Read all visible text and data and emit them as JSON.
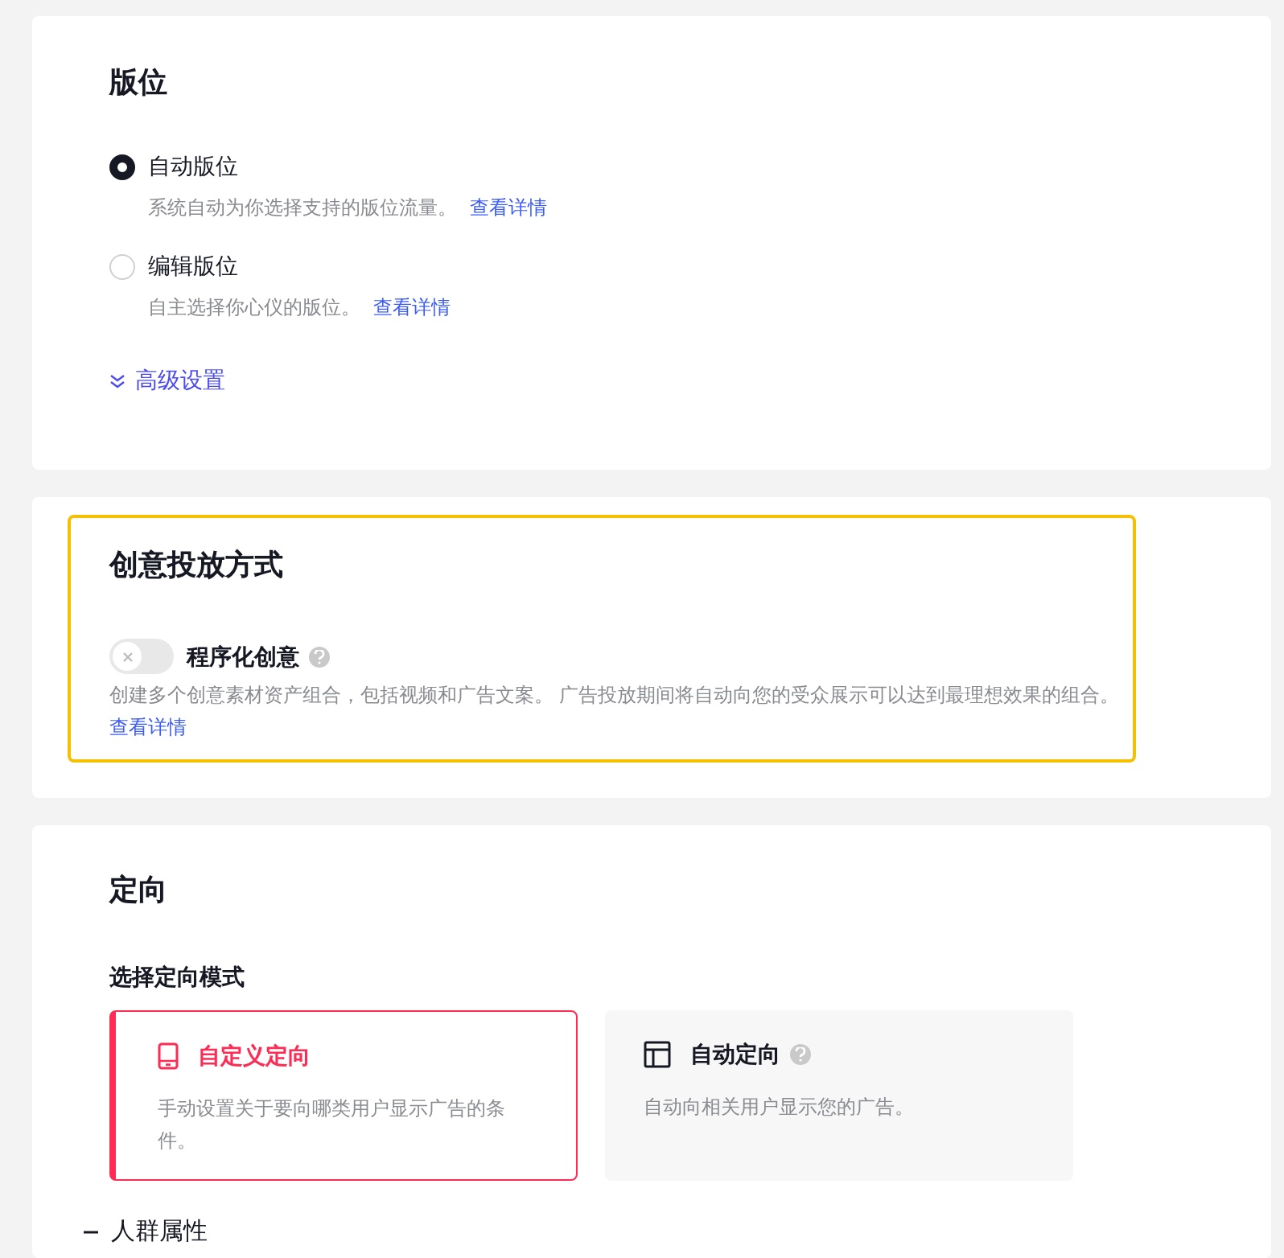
{
  "placement": {
    "title": "版位",
    "options": [
      {
        "label": "自动版位",
        "description": "系统自动为你选择支持的版位流量。",
        "link": "查看详情",
        "selected": true
      },
      {
        "label": "编辑版位",
        "description": "自主选择你心仪的版位。",
        "link": "查看详情",
        "selected": false
      }
    ],
    "advanced": "高级设置"
  },
  "creative": {
    "title": "创意投放方式",
    "highlighted": true,
    "toggle": {
      "label": "程序化创意",
      "on": false
    },
    "description": "创建多个创意素材资产组合，包括视频和广告文案。 广告投放期间将自动向您的受众展示可以达到最理想效果的组合。",
    "link": "查看详情"
  },
  "targeting": {
    "title": "定向",
    "mode_label": "选择定向模式",
    "modes": [
      {
        "kind": "custom",
        "label": "自定义定向",
        "description": "手动设置关于要向哪类用户显示广告的条件。",
        "help": false,
        "selected": true
      },
      {
        "kind": "auto",
        "label": "自动定向",
        "description": "自动向相关用户显示您的广告。",
        "help": true,
        "selected": false
      }
    ],
    "section": "人群属性"
  }
}
